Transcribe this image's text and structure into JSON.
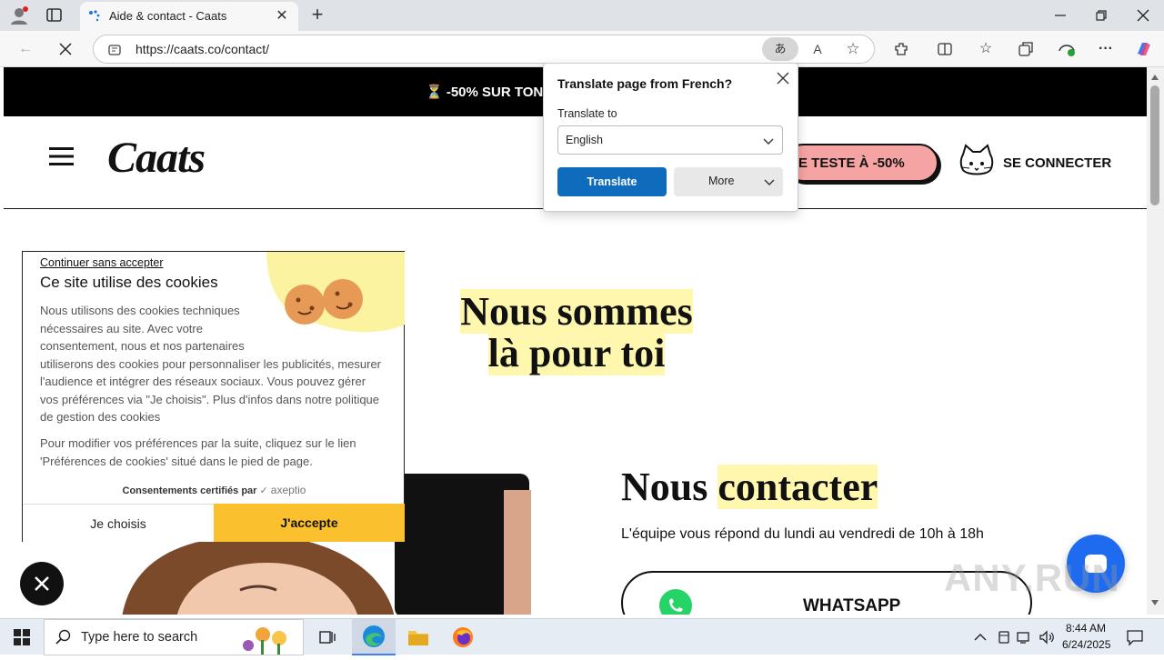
{
  "browser": {
    "tab_title": "Aide & contact - Caats",
    "url": "https://caats.co/contact/"
  },
  "site": {
    "promo_text": "⏳ -50% SUR TON",
    "logo": "Caats",
    "cta_label": "E TESTE À -50%",
    "login_label": "SE CONNECTER",
    "hero_line1": "Nous sommes",
    "hero_line2": "là pour toi",
    "contact_word1": "Nous",
    "contact_word2": "contacter",
    "contact_sub": "L'équipe vous répond du lundi au vendredi de 10h à 18h",
    "whatsapp_label": "WHATSAPP"
  },
  "cookie": {
    "skip_link": "Continuer sans accepter",
    "title": "Ce site utilise des cookies",
    "body1_lines": [
      "Nous utilisons des cookies techniques",
      "nécessaires au site. Avec votre",
      "consentement, nous et nos partenaires",
      "utiliserons des cookies pour personnaliser les publicités, mesurer",
      "l'audience et intégrer des réseaux sociaux. Vous pouvez gérer",
      "vos préférences via \"Je choisis\". Plus d'infos dans notre politique",
      "de gestion des cookies"
    ],
    "body2_lines": [
      "Pour modifier vos préférences par la suite, cliquez sur le lien",
      "'Préférences de cookies' situé dans le pied de page."
    ],
    "certified": "Consentements certifiés par",
    "certified_brand": "axeptio",
    "choose_label": "Je choisis",
    "accept_label": "J'accepte"
  },
  "translate_popup": {
    "title": "Translate page from French?",
    "translate_to_label": "Translate to",
    "language": "English",
    "translate_button": "Translate",
    "more_button": "More"
  },
  "taskbar": {
    "search_placeholder": "Type here to search",
    "time": "8:44 AM",
    "date": "6/24/2025"
  },
  "watermark": "ANY.RUN",
  "colors": {
    "accent_yellow": "#fbc02d",
    "cta_pink": "#f6a3a3",
    "translate_blue": "#0f6cbd",
    "highlight": "#fff7ad"
  }
}
